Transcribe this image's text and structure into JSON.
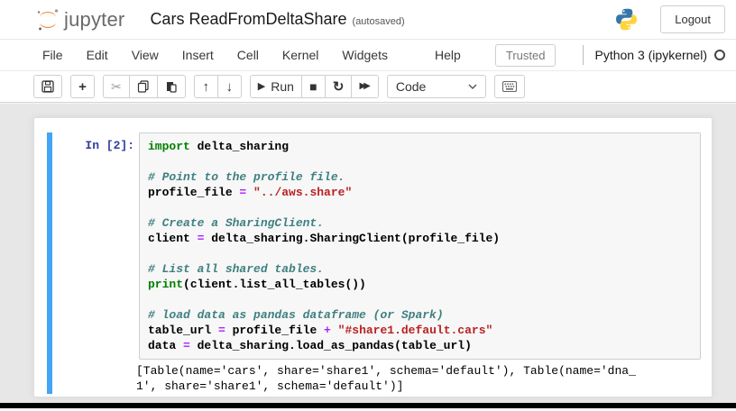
{
  "header": {
    "logo_text": "jupyter",
    "notebook_title": "Cars ReadFromDeltaShare",
    "autosave_status": "(autosaved)",
    "logout_label": "Logout"
  },
  "menubar": {
    "items": [
      "File",
      "Edit",
      "View",
      "Insert",
      "Cell",
      "Kernel",
      "Widgets",
      "Help"
    ],
    "trusted_label": "Trusted",
    "kernel_name": "Python 3 (ipykernel)",
    "kernel_status": "idle"
  },
  "toolbar": {
    "run_label": "Run",
    "cell_type_selected": "Code",
    "buttons": [
      "save",
      "add-cell-below",
      "cut-cells",
      "copy-cells",
      "paste-cells",
      "move-cell-up",
      "move-cell-down",
      "run",
      "interrupt-kernel",
      "restart-kernel",
      "restart-and-run-all",
      "cell-type-dropdown",
      "command-palette"
    ]
  },
  "icons": {
    "save": "floppy-disk",
    "add": "+",
    "cut": "✂",
    "up": "↑",
    "down": "↓",
    "run": "▶",
    "stop": "■",
    "restart": "↻",
    "fast_forward": "▶▶"
  },
  "cell": {
    "input_prompt": "In [2]:",
    "code_lines": [
      [
        {
          "t": "kw",
          "v": "import"
        },
        {
          "t": "txt",
          "v": " delta_sharing"
        }
      ],
      [],
      [
        {
          "t": "com",
          "v": "# Point to the profile file."
        }
      ],
      [
        {
          "t": "txt",
          "v": "profile_file "
        },
        {
          "t": "op",
          "v": "="
        },
        {
          "t": "txt",
          "v": " "
        },
        {
          "t": "str",
          "v": "\"../aws.share\""
        }
      ],
      [],
      [
        {
          "t": "com",
          "v": "# Create a SharingClient."
        }
      ],
      [
        {
          "t": "txt",
          "v": "client "
        },
        {
          "t": "op",
          "v": "="
        },
        {
          "t": "txt",
          "v": " delta_sharing.SharingClient(profile_file)"
        }
      ],
      [],
      [
        {
          "t": "com",
          "v": "# List all shared tables."
        }
      ],
      [
        {
          "t": "kw2",
          "v": "print"
        },
        {
          "t": "txt",
          "v": "(client.list_all_tables())"
        }
      ],
      [],
      [
        {
          "t": "com",
          "v": "# load data as pandas dataframe (or Spark)"
        }
      ],
      [
        {
          "t": "txt",
          "v": "table_url "
        },
        {
          "t": "op",
          "v": "="
        },
        {
          "t": "txt",
          "v": " profile_file "
        },
        {
          "t": "op",
          "v": "+"
        },
        {
          "t": "txt",
          "v": " "
        },
        {
          "t": "str",
          "v": "\"#share1.default.cars\""
        }
      ],
      [
        {
          "t": "txt",
          "v": "data "
        },
        {
          "t": "op",
          "v": "="
        },
        {
          "t": "txt",
          "v": " delta_sharing.load_as_pandas(table_url)"
        }
      ]
    ],
    "output_lines": [
      "[Table(name='cars', share='share1', schema='default'), Table(name='dna_",
      "1', share='share1', schema='default')]"
    ]
  },
  "colors": {
    "jupyter_orange": "#F37726",
    "logo_gray": "#6a6a6a",
    "selected_cell_blue": "#42A5F5",
    "prompt_blue": "#303F9F",
    "keyword_green": "#008000",
    "comment_teal": "#408080",
    "string_red": "#BA2121",
    "operator_purple": "#AA22FF",
    "python_blue": "#3776AB",
    "python_yellow": "#FFD43B",
    "body_gray": "#e7e7e7"
  }
}
